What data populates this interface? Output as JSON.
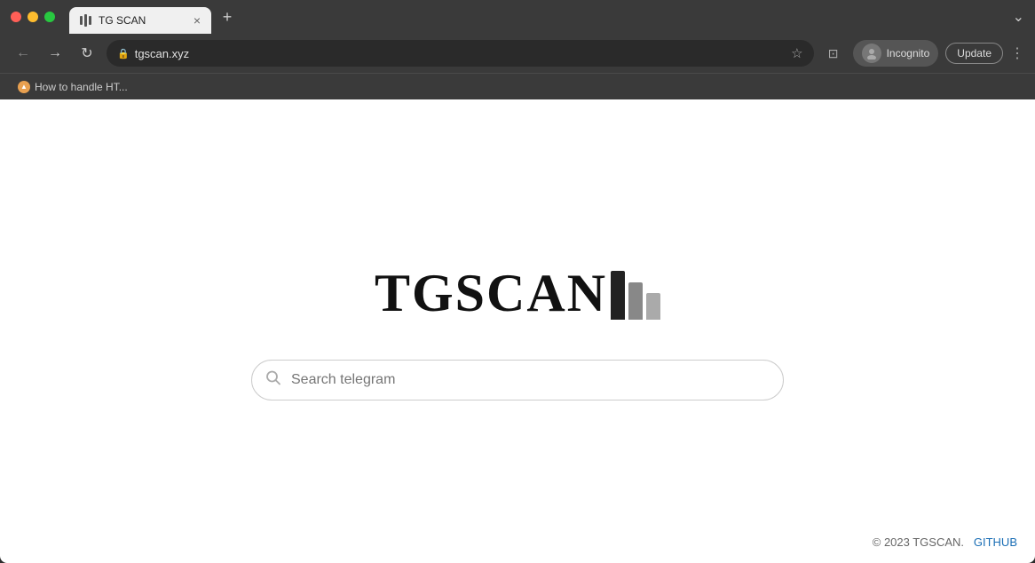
{
  "browser": {
    "tab": {
      "icon": "grid-icon",
      "title": "TG SCAN",
      "close_label": "×"
    },
    "new_tab_label": "+",
    "collapse_label": "⌄",
    "nav": {
      "back_label": "←",
      "forward_label": "→",
      "refresh_label": "↻",
      "address": "tgscan.xyz",
      "star_label": "☆",
      "split_label": "⊡"
    },
    "incognito": {
      "label": "Incognito"
    },
    "update_label": "Update",
    "menu_label": "⋮"
  },
  "bookmarks": {
    "item_label": "How to handle HT..."
  },
  "page": {
    "logo_text": "TGSCAN",
    "search_placeholder": "Search telegram",
    "footer_text": "© 2023 TGSCAN.",
    "footer_link_text": "GITHUB"
  },
  "colors": {
    "accent_blue": "#1a6eb5",
    "logo_bar1": "#222222",
    "logo_bar2": "#888888",
    "logo_bar3": "#aaaaaa"
  }
}
